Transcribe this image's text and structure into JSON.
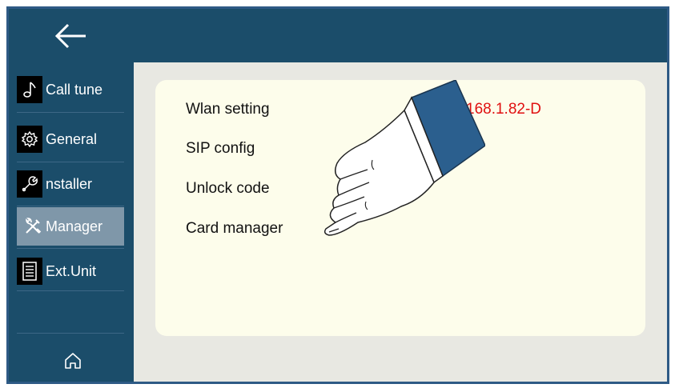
{
  "header": {
    "back_icon": "arrow-left-icon"
  },
  "sidebar": {
    "items": [
      {
        "label": "Call tune",
        "icon": "music-note-icon"
      },
      {
        "label": "General",
        "icon": "gear-icon"
      },
      {
        "label": "nstaller",
        "icon": "wrench-icon"
      },
      {
        "label": "Manager",
        "icon": "tools-icon",
        "active": true
      },
      {
        "label": "Ext.Unit",
        "icon": "document-icon"
      }
    ],
    "home_icon": "home-icon"
  },
  "main": {
    "menu": [
      "Wlan setting",
      "SIP config",
      "Unlock code",
      "Card manager"
    ],
    "ip_text": "168.1.82-D"
  },
  "colors": {
    "header": "#1b4d6a",
    "active_item": "#7f97a9",
    "card": "#fdfdeb",
    "main_bg": "#e8e8e2",
    "ip_text": "#e01010"
  }
}
